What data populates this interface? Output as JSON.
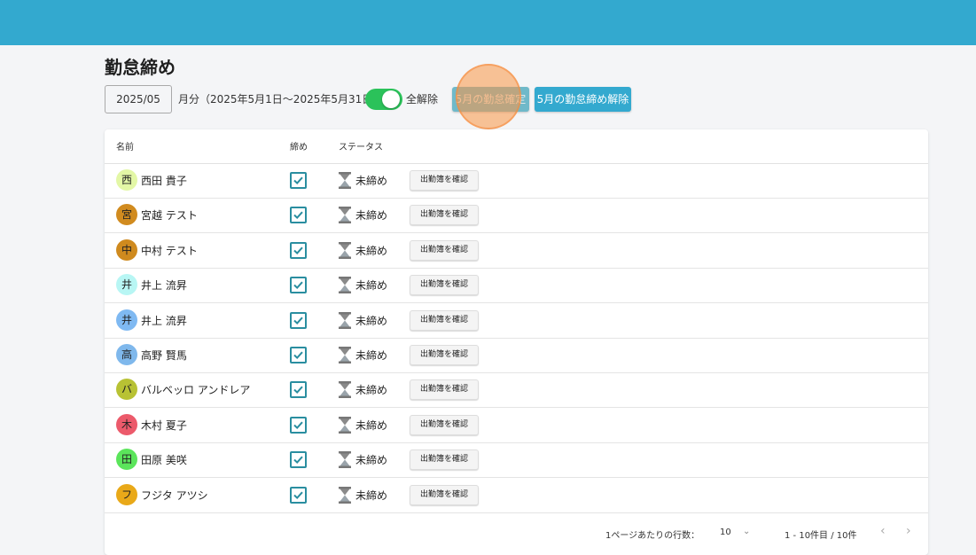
{
  "header": {
    "title": "勤怠締め"
  },
  "controls": {
    "month_value": "2025/05",
    "period_text": "月分（2025年5月1日〜2025年5月31日）",
    "toggle_label": "全解除",
    "toggle_on": true,
    "confirm_button": "5月の勤怠確定",
    "unlock_button": "5月の勤怠締め解除"
  },
  "table": {
    "columns": {
      "name": "名前",
      "closing": "締め",
      "status": "ステータス"
    },
    "action_label": "出勤簿を確認",
    "rows": [
      {
        "initial": "西",
        "name": "西田 貴子",
        "status": "未締め",
        "avatar_color": "#e3f7a6",
        "checked": true
      },
      {
        "initial": "宮",
        "name": "宮越 テスト",
        "status": "未締め",
        "avatar_color": "#d18b1f",
        "checked": true
      },
      {
        "initial": "中",
        "name": "中村 テスト",
        "status": "未締め",
        "avatar_color": "#cf8a1e",
        "checked": true
      },
      {
        "initial": "井",
        "name": "井上 流昇",
        "status": "未締め",
        "avatar_color": "#b8f6f4",
        "checked": true
      },
      {
        "initial": "井",
        "name": "井上 流昇",
        "status": "未締め",
        "avatar_color": "#7fb9f2",
        "checked": true
      },
      {
        "initial": "高",
        "name": "高野 賢馬",
        "status": "未締め",
        "avatar_color": "#7fb8ec",
        "checked": true
      },
      {
        "initial": "バ",
        "name": "バルベッロ アンドレア",
        "status": "未締め",
        "avatar_color": "#b8c234",
        "checked": true
      },
      {
        "initial": "木",
        "name": "木村 夏子",
        "status": "未締め",
        "avatar_color": "#ec5a6b",
        "checked": true
      },
      {
        "initial": "田",
        "name": "田原 美咲",
        "status": "未締め",
        "avatar_color": "#5be55b",
        "checked": true
      },
      {
        "initial": "フ",
        "name": "フジタ アツシ",
        "status": "未締め",
        "avatar_color": "#e9a919",
        "checked": true
      }
    ]
  },
  "pagination": {
    "rows_per_page_label": "1ページあたりの行数：",
    "rows_per_page": "10",
    "range": "1 - 10件目 / 10件",
    "prev": "‹",
    "next": "›"
  },
  "colors": {
    "header_bar": "#33a9cf",
    "primary_button": "#33a9cf",
    "toggle_on": "#2bc25a",
    "checkbox": "#2a8ea0"
  },
  "icons": {
    "hourglass": "hourglass-icon",
    "checkbox": "checkbox-checked-icon",
    "dropdown": "chevron-down-icon"
  }
}
